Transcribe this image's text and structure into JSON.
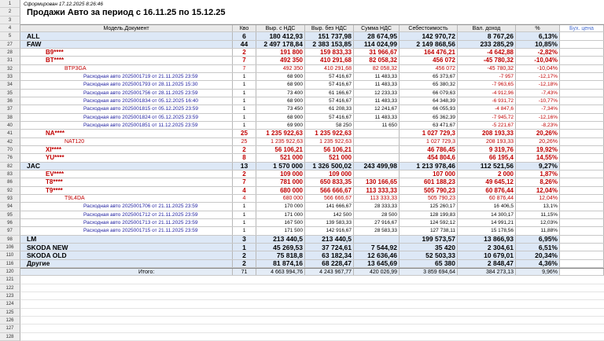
{
  "header": {
    "timestamp": "Сформирован 17.12.2025 8:26:46",
    "title": "Продажи Авто за период с 16.11.25 по  15.12.25"
  },
  "columns": [
    "Модель.Документ",
    "Кво",
    "Выр. с НДС",
    "Выр. без НДС",
    "Сумма НДС",
    "Себестоимость",
    "Вал. доход",
    "%",
    "Бух. цена"
  ],
  "colors": {
    "red": "#c00000",
    "purple": "#2020a0",
    "blue_header": "#4a6fd0",
    "row_bg": "#dde8f6",
    "total_bg": "#e4ecf6"
  },
  "rows": [
    {
      "rn": "1",
      "type": "ts"
    },
    {
      "rn": "2",
      "type": "title"
    },
    {
      "rn": "3",
      "type": "empty"
    },
    {
      "rn": "4",
      "type": "header"
    },
    {
      "rn": "5",
      "type": "l1",
      "cells": [
        "ALL",
        "6",
        "180 412,93",
        "151 737,98",
        "28 674,95",
        "142 970,72",
        "8 767,26",
        "6,13%",
        ""
      ]
    },
    {
      "rn": "27",
      "type": "l1",
      "cells": [
        "FAW",
        "44",
        "2 497 178,84",
        "2 383 153,85",
        "114 024,99",
        "2 149 868,56",
        "233 285,29",
        "10,85%",
        ""
      ]
    },
    {
      "rn": "28",
      "type": "l2",
      "cells": [
        "B9****",
        "2",
        "191 800",
        "159 833,33",
        "31 966,67",
        "164 476,21",
        "-4 642,88",
        "-2,82%",
        ""
      ]
    },
    {
      "rn": "31",
      "type": "l2",
      "cells": [
        "BT****",
        "7",
        "492 350",
        "410 291,68",
        "82 058,32",
        "456 072",
        "-45 780,32",
        "-10,04%",
        ""
      ]
    },
    {
      "rn": "32",
      "type": "l3",
      "cells": [
        "BTP3GA",
        "7",
        "492 350",
        "410 291,68",
        "82 058,32",
        "456 072",
        "-45 780,32",
        "-10,04%",
        ""
      ]
    },
    {
      "rn": "33",
      "type": "doc",
      "cells": [
        "Расходная авто 2025001719 от 21.11.2025 23:59",
        "1",
        "68 900",
        "57 416,67",
        "11 483,33",
        "65 373,67",
        "-7 957",
        "-12,17%",
        ""
      ]
    },
    {
      "rn": "34",
      "type": "doc",
      "cells": [
        "Расходная авто 2025001793 от 28.11.2025 15:30",
        "1",
        "68 900",
        "57 416,67",
        "11 483,33",
        "65 380,32",
        "-7 963,65",
        "-12,18%",
        ""
      ]
    },
    {
      "rn": "35",
      "type": "doc",
      "cells": [
        "Расходная авто 2025001756 от 28.11.2025 23:59",
        "1",
        "73 400",
        "61 166,67",
        "12 233,33",
        "66 079,63",
        "-4 912,96",
        "-7,43%",
        ""
      ]
    },
    {
      "rn": "36",
      "type": "doc",
      "cells": [
        "Расходная авто 2025001834 от 05.12.2025 16:40",
        "1",
        "68 900",
        "57 416,67",
        "11 483,33",
        "64 348,39",
        "-6 931,72",
        "-10,77%",
        ""
      ]
    },
    {
      "rn": "37",
      "type": "doc",
      "cells": [
        "Расходная авто 2025001815 от 05.12.2025 23:59",
        "1",
        "73 450",
        "61 208,33",
        "12 241,67",
        "66 055,93",
        "-4 847,6",
        "-7,34%",
        ""
      ]
    },
    {
      "rn": "38",
      "type": "doc",
      "cells": [
        "Расходная авто 2025001824 от 05.12.2025 23:59",
        "1",
        "68 900",
        "57 416,67",
        "11 483,33",
        "65 362,39",
        "-7 945,72",
        "-12,16%",
        ""
      ]
    },
    {
      "rn": "40",
      "type": "doc",
      "cells": [
        "Расходная авто 2025001851 от 11.12.2025 23:59",
        "1",
        "69 900",
        "58 250",
        "11 650",
        "63 471,67",
        "-5 221,67",
        "-8,23%",
        ""
      ]
    },
    {
      "rn": "41",
      "type": "l2",
      "cells": [
        "NA****",
        "25",
        "1 235 922,63",
        "1 235 922,63",
        "",
        "1 027 729,3",
        "208 193,33",
        "20,26%",
        ""
      ]
    },
    {
      "rn": "42",
      "type": "l3",
      "cells": [
        "NAT120",
        "25",
        "1 235 922,63",
        "1 235 922,63",
        "",
        "1 027 729,3",
        "208 193,33",
        "20,26%",
        ""
      ]
    },
    {
      "rn": "70",
      "type": "l2",
      "cells": [
        "XI****",
        "2",
        "56 106,21",
        "56 106,21",
        "",
        "46 786,45",
        "9 319,76",
        "19,92%",
        ""
      ]
    },
    {
      "rn": "76",
      "type": "l2",
      "cells": [
        "YU****",
        "8",
        "521 000",
        "521 000",
        "",
        "454 804,6",
        "66 195,4",
        "14,55%",
        ""
      ]
    },
    {
      "rn": "82",
      "type": "l1",
      "cells": [
        "JAC",
        "13",
        "1 570 000",
        "1 326 500,02",
        "243 499,98",
        "1 213 978,46",
        "112 521,56",
        "9,27%",
        ""
      ]
    },
    {
      "rn": "83",
      "type": "l2",
      "cells": [
        "EV****",
        "2",
        "109 000",
        "109 000",
        "",
        "107 000",
        "2 000",
        "1,87%",
        ""
      ]
    },
    {
      "rn": "86",
      "type": "l2",
      "cells": [
        "T8****",
        "7",
        "781 000",
        "650 833,35",
        "130 166,65",
        "601 188,23",
        "49 645,12",
        "8,26%",
        ""
      ]
    },
    {
      "rn": "92",
      "type": "l2",
      "cells": [
        "T9****",
        "4",
        "680 000",
        "566 666,67",
        "113 333,33",
        "505 790,23",
        "60 876,44",
        "12,04%",
        ""
      ]
    },
    {
      "rn": "93",
      "type": "l3",
      "cells": [
        "T9L4DA",
        "4",
        "680 000",
        "566 666,67",
        "113 333,33",
        "505 790,23",
        "60 876,44",
        "12,04%",
        ""
      ]
    },
    {
      "rn": "94",
      "type": "doc",
      "cells": [
        "Расходная авто 2025001706 от 21.11.2025 23:59",
        "1",
        "170 000",
        "141 666,67",
        "28 333,33",
        "125 260,17",
        "16 406,5",
        "13,1%",
        ""
      ]
    },
    {
      "rn": "95",
      "type": "doc",
      "cells": [
        "Расходная авто 2025001712 от 21.11.2025 23:59",
        "1",
        "171 000",
        "142 500",
        "28 500",
        "128 199,83",
        "14 300,17",
        "11,15%",
        ""
      ]
    },
    {
      "rn": "96",
      "type": "doc",
      "cells": [
        "Расходная авто 2025001713 от 21.11.2025 23:59",
        "1",
        "167 500",
        "139 583,33",
        "27 916,67",
        "124 592,12",
        "14 991,21",
        "12,03%",
        ""
      ]
    },
    {
      "rn": "97",
      "type": "doc",
      "cells": [
        "Расходная авто 2025001715 от 21.11.2025 23:59",
        "1",
        "171 500",
        "142 916,67",
        "28 583,33",
        "127 738,11",
        "15 178,56",
        "11,88%",
        ""
      ]
    },
    {
      "rn": "98",
      "type": "l1",
      "cells": [
        "LM",
        "3",
        "213 440,5",
        "213 440,5",
        "",
        "199 573,57",
        "13 866,93",
        "6,95%",
        ""
      ]
    },
    {
      "rn": "106",
      "type": "l1",
      "cells": [
        "SKODA  NEW",
        "1",
        "45 269,53",
        "37 724,61",
        "7 544,92",
        "35 420",
        "2 304,61",
        "6,51%",
        ""
      ]
    },
    {
      "rn": "110",
      "type": "l1",
      "cells": [
        "SKODA OLD",
        "2",
        "75 818,8",
        "63 182,34",
        "12 636,46",
        "52 503,33",
        "10 679,01",
        "20,34%",
        ""
      ]
    },
    {
      "rn": "116",
      "type": "l1",
      "cells": [
        "Другие",
        "2",
        "81 874,16",
        "68 228,47",
        "13 645,69",
        "65 380",
        "2 848,47",
        "4,36%",
        ""
      ]
    },
    {
      "rn": "120",
      "type": "total",
      "cells": [
        "Итого:",
        "71",
        "4 663 994,76",
        "4 243 967,77",
        "420 026,99",
        "3 859 694,64",
        "384 273,13",
        "9,96%",
        ""
      ]
    },
    {
      "rn": "121",
      "type": "empty"
    },
    {
      "rn": "122",
      "type": "empty"
    },
    {
      "rn": "123",
      "type": "empty"
    },
    {
      "rn": "124",
      "type": "empty"
    },
    {
      "rn": "125",
      "type": "empty"
    },
    {
      "rn": "126",
      "type": "empty"
    },
    {
      "rn": "127",
      "type": "empty"
    },
    {
      "rn": "128",
      "type": "empty"
    }
  ]
}
